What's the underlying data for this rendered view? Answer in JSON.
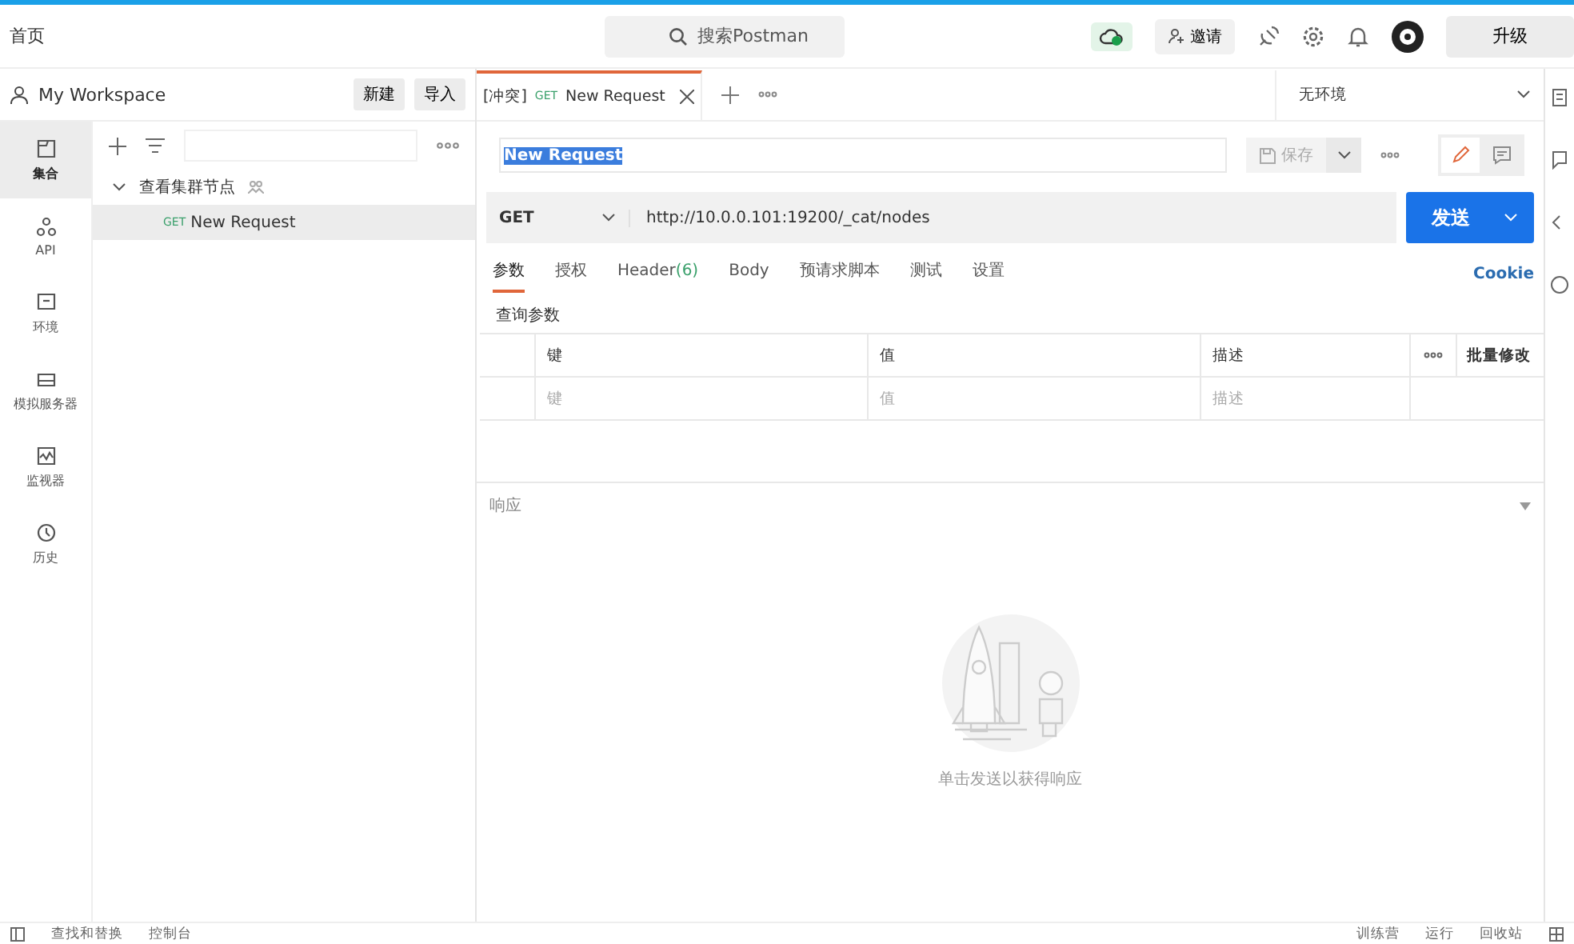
{
  "top_bar": {
    "home": "首页",
    "search_placeholder": "搜索Postman",
    "invite": "邀请",
    "upgrade": "升级"
  },
  "workspace": {
    "name": "My Workspace",
    "buttons": [
      "新建",
      "导入"
    ]
  },
  "rail": [
    {
      "label": "集合",
      "kind": "collections",
      "selected": true
    },
    {
      "label": "API",
      "kind": "api",
      "selected": false
    },
    {
      "label": "环境",
      "kind": "environment",
      "selected": false
    },
    {
      "label": "模拟服务器",
      "kind": "mock",
      "selected": false
    },
    {
      "label": "监视器",
      "kind": "monitor",
      "selected": false
    },
    {
      "label": "历史",
      "kind": "history",
      "selected": false
    }
  ],
  "collections": [
    {
      "name": "查看集群节点",
      "expanded": true,
      "children": [
        {
          "method": "GET",
          "name": "New Request",
          "selected": true
        }
      ]
    }
  ],
  "tabs": [
    {
      "prefix": "[冲突]",
      "method": "GET",
      "name": "New Request",
      "selected": true
    }
  ],
  "environment": "无环境",
  "request": {
    "name": "New Request",
    "save": "保存",
    "method": "GET",
    "url": "http://10.0.0.101:19200/_cat/nodes",
    "send": "发送"
  },
  "req_tabs": [
    {
      "label": "参数",
      "selected": true
    },
    {
      "label": "授权",
      "selected": false
    },
    {
      "label": "Header",
      "count": "(6)",
      "selected": false
    },
    {
      "label": "Body",
      "selected": false
    },
    {
      "label": "预请求脚本",
      "selected": false
    },
    {
      "label": "测试",
      "selected": false
    },
    {
      "label": "设置",
      "selected": false
    }
  ],
  "cookie": "Cookie",
  "params": {
    "title": "查询参数",
    "columns": [
      "键",
      "值",
      "描述"
    ],
    "bulk_edit": "批量修改",
    "placeholders": [
      "键",
      "值",
      "描述"
    ]
  },
  "response": {
    "title": "响应",
    "hint": "单击发送以获得响应"
  },
  "status_bar": {
    "left": [
      "查找和替换",
      "控制台"
    ],
    "right": [
      "训练营",
      "运行",
      "回收站"
    ]
  }
}
